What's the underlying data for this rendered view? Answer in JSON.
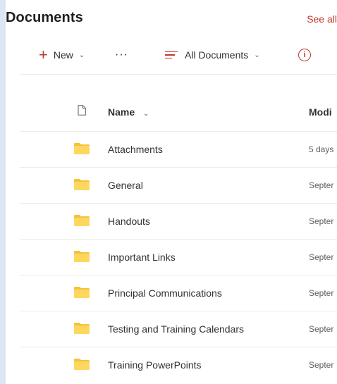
{
  "header": {
    "title": "Documents",
    "see_all": "See all"
  },
  "toolbar": {
    "new_label": "New",
    "more_icon": "ellipsis-icon",
    "view_label": "All Documents",
    "info_icon": "info-icon"
  },
  "table": {
    "columns": {
      "name": "Name",
      "modified": "Modi"
    },
    "rows": [
      {
        "name": "Attachments",
        "modified": "5 days"
      },
      {
        "name": "General",
        "modified": "Septer"
      },
      {
        "name": "Handouts",
        "modified": "Septer"
      },
      {
        "name": "Important Links",
        "modified": "Septer"
      },
      {
        "name": "Principal Communications",
        "modified": "Septer"
      },
      {
        "name": "Testing and Training Calendars",
        "modified": "Septer"
      },
      {
        "name": "Training PowerPoints",
        "modified": "Septer"
      }
    ]
  },
  "colors": {
    "accent": "#c0392b",
    "folder": "#f6c13b",
    "background": "#dfe6f3"
  }
}
